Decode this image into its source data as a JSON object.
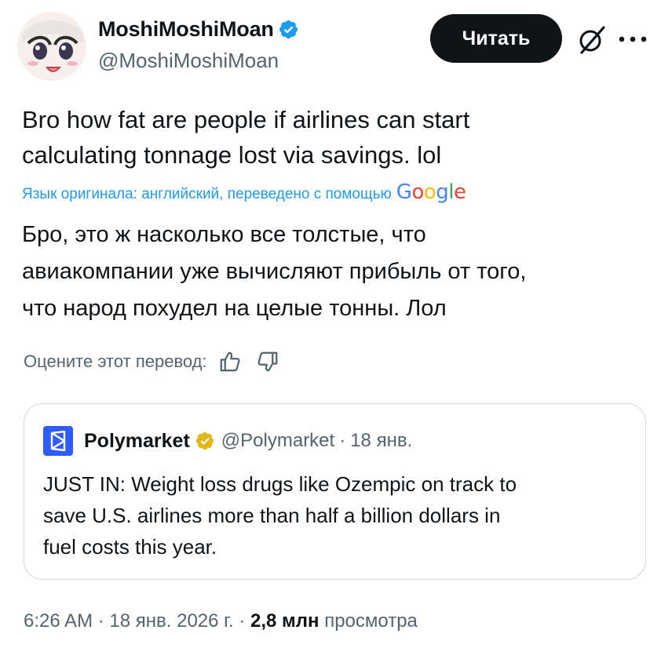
{
  "author": {
    "display_name": "MoshiMoshiMoan",
    "handle": "@MoshiMoshiMoan",
    "verified": true,
    "verified_color": "#1d9bf0"
  },
  "actions": {
    "read_label": "Читать",
    "icons": [
      "grok-icon",
      "more-icon"
    ]
  },
  "tweet": {
    "text_line1": "Bro how fat are people if airlines can start",
    "text_line2": "calculating tonnage lost via savings. lol",
    "translation_note": "Язык оригинала: английский, переведено с помощью",
    "translation_provider": "Google",
    "translated_line1": "Бро, это ж насколько все толстые, что",
    "translated_line2": "авиакомпании уже вычисляют прибыль от того,",
    "translated_line3": "что народ похудел на целые тонны. Лол",
    "rate_label": "Оцените этот перевод:"
  },
  "quote": {
    "display_name": "Polymarket",
    "handle": "@Polymarket",
    "separator": "·",
    "date": "18 янв.",
    "badge_color": "#e2b719",
    "brand_color": "#2e5cff",
    "text_line1": "JUST IN: Weight loss drugs like Ozempic on track to",
    "text_line2": "save U.S. airlines more than half a billion dollars in",
    "text_line3": "fuel costs this year."
  },
  "meta": {
    "time": "6:26 AM",
    "separator": "·",
    "date": "18 янв. 2026 г.",
    "views_count": "2,8 млн",
    "views_label": "просмотра"
  }
}
